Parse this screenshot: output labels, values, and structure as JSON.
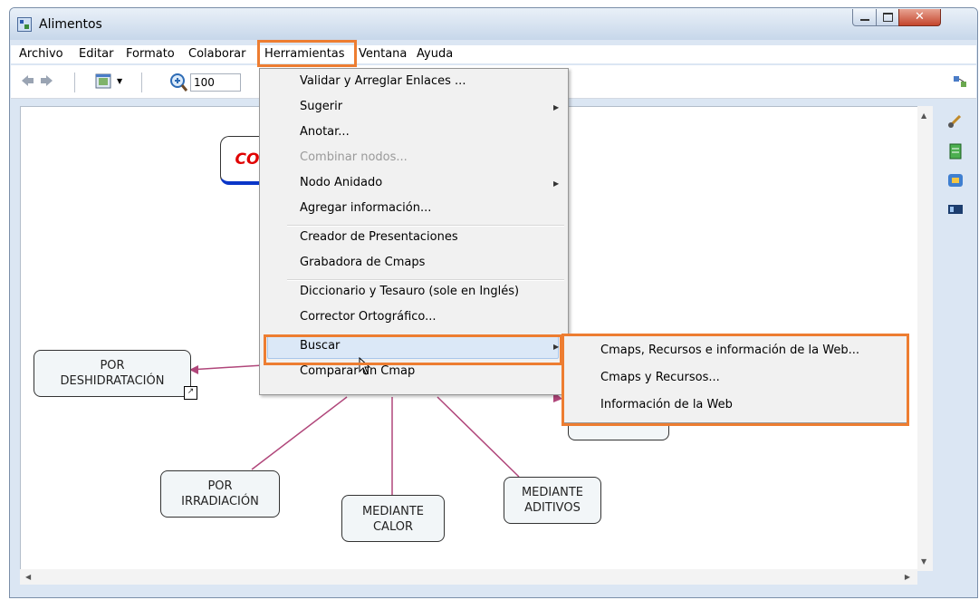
{
  "window": {
    "title": "Alimentos"
  },
  "menubar": [
    "Archivo",
    "Editar",
    "Formato",
    "Colaborar",
    "Herramientas",
    "Ventana",
    "Ayuda"
  ],
  "toolbar": {
    "zoom_value": "100"
  },
  "concept_map": {
    "root_partial": "CO",
    "nodes": [
      {
        "line1": "POR",
        "line2": "DESHIDRATACIÓN"
      },
      {
        "line1": "POR",
        "line2": "IRRADIACIÓN"
      },
      {
        "line1": "MEDIANTE",
        "line2": "CALOR"
      },
      {
        "line1": "MEDIANTE",
        "line2": "ADITIVOS"
      }
    ]
  },
  "herramientas_menu": {
    "items": [
      {
        "label": "Validar y Arreglar Enlaces ...",
        "enabled": true
      },
      {
        "label": "Sugerir",
        "enabled": true,
        "submenu": true
      },
      {
        "label": "Anotar...",
        "enabled": true
      },
      {
        "label": "Combinar nodos...",
        "enabled": false
      },
      {
        "label": "Nodo Anidado",
        "enabled": true,
        "submenu": true
      },
      {
        "label": "Agregar información...",
        "enabled": true
      },
      {
        "label": "Creador de Presentaciones",
        "enabled": true
      },
      {
        "label": "Grabadora de Cmaps",
        "enabled": true
      },
      {
        "label": "Diccionario y Tesauro (sole en Inglés)",
        "enabled": true
      },
      {
        "label": "Corrector Ortográfico...",
        "enabled": true
      },
      {
        "label": "Buscar",
        "enabled": true,
        "submenu": true,
        "highlighted": true
      },
      {
        "label": "Comparar un Cmap",
        "enabled": true
      }
    ]
  },
  "buscar_submenu": {
    "items": [
      "Cmaps, Recursos e información de la Web...",
      "Cmaps y Recursos...",
      "Información de la Web"
    ]
  },
  "colors": {
    "highlight": "#ed7d31",
    "link_line": "#b0467a",
    "root_text": "#e00000"
  }
}
